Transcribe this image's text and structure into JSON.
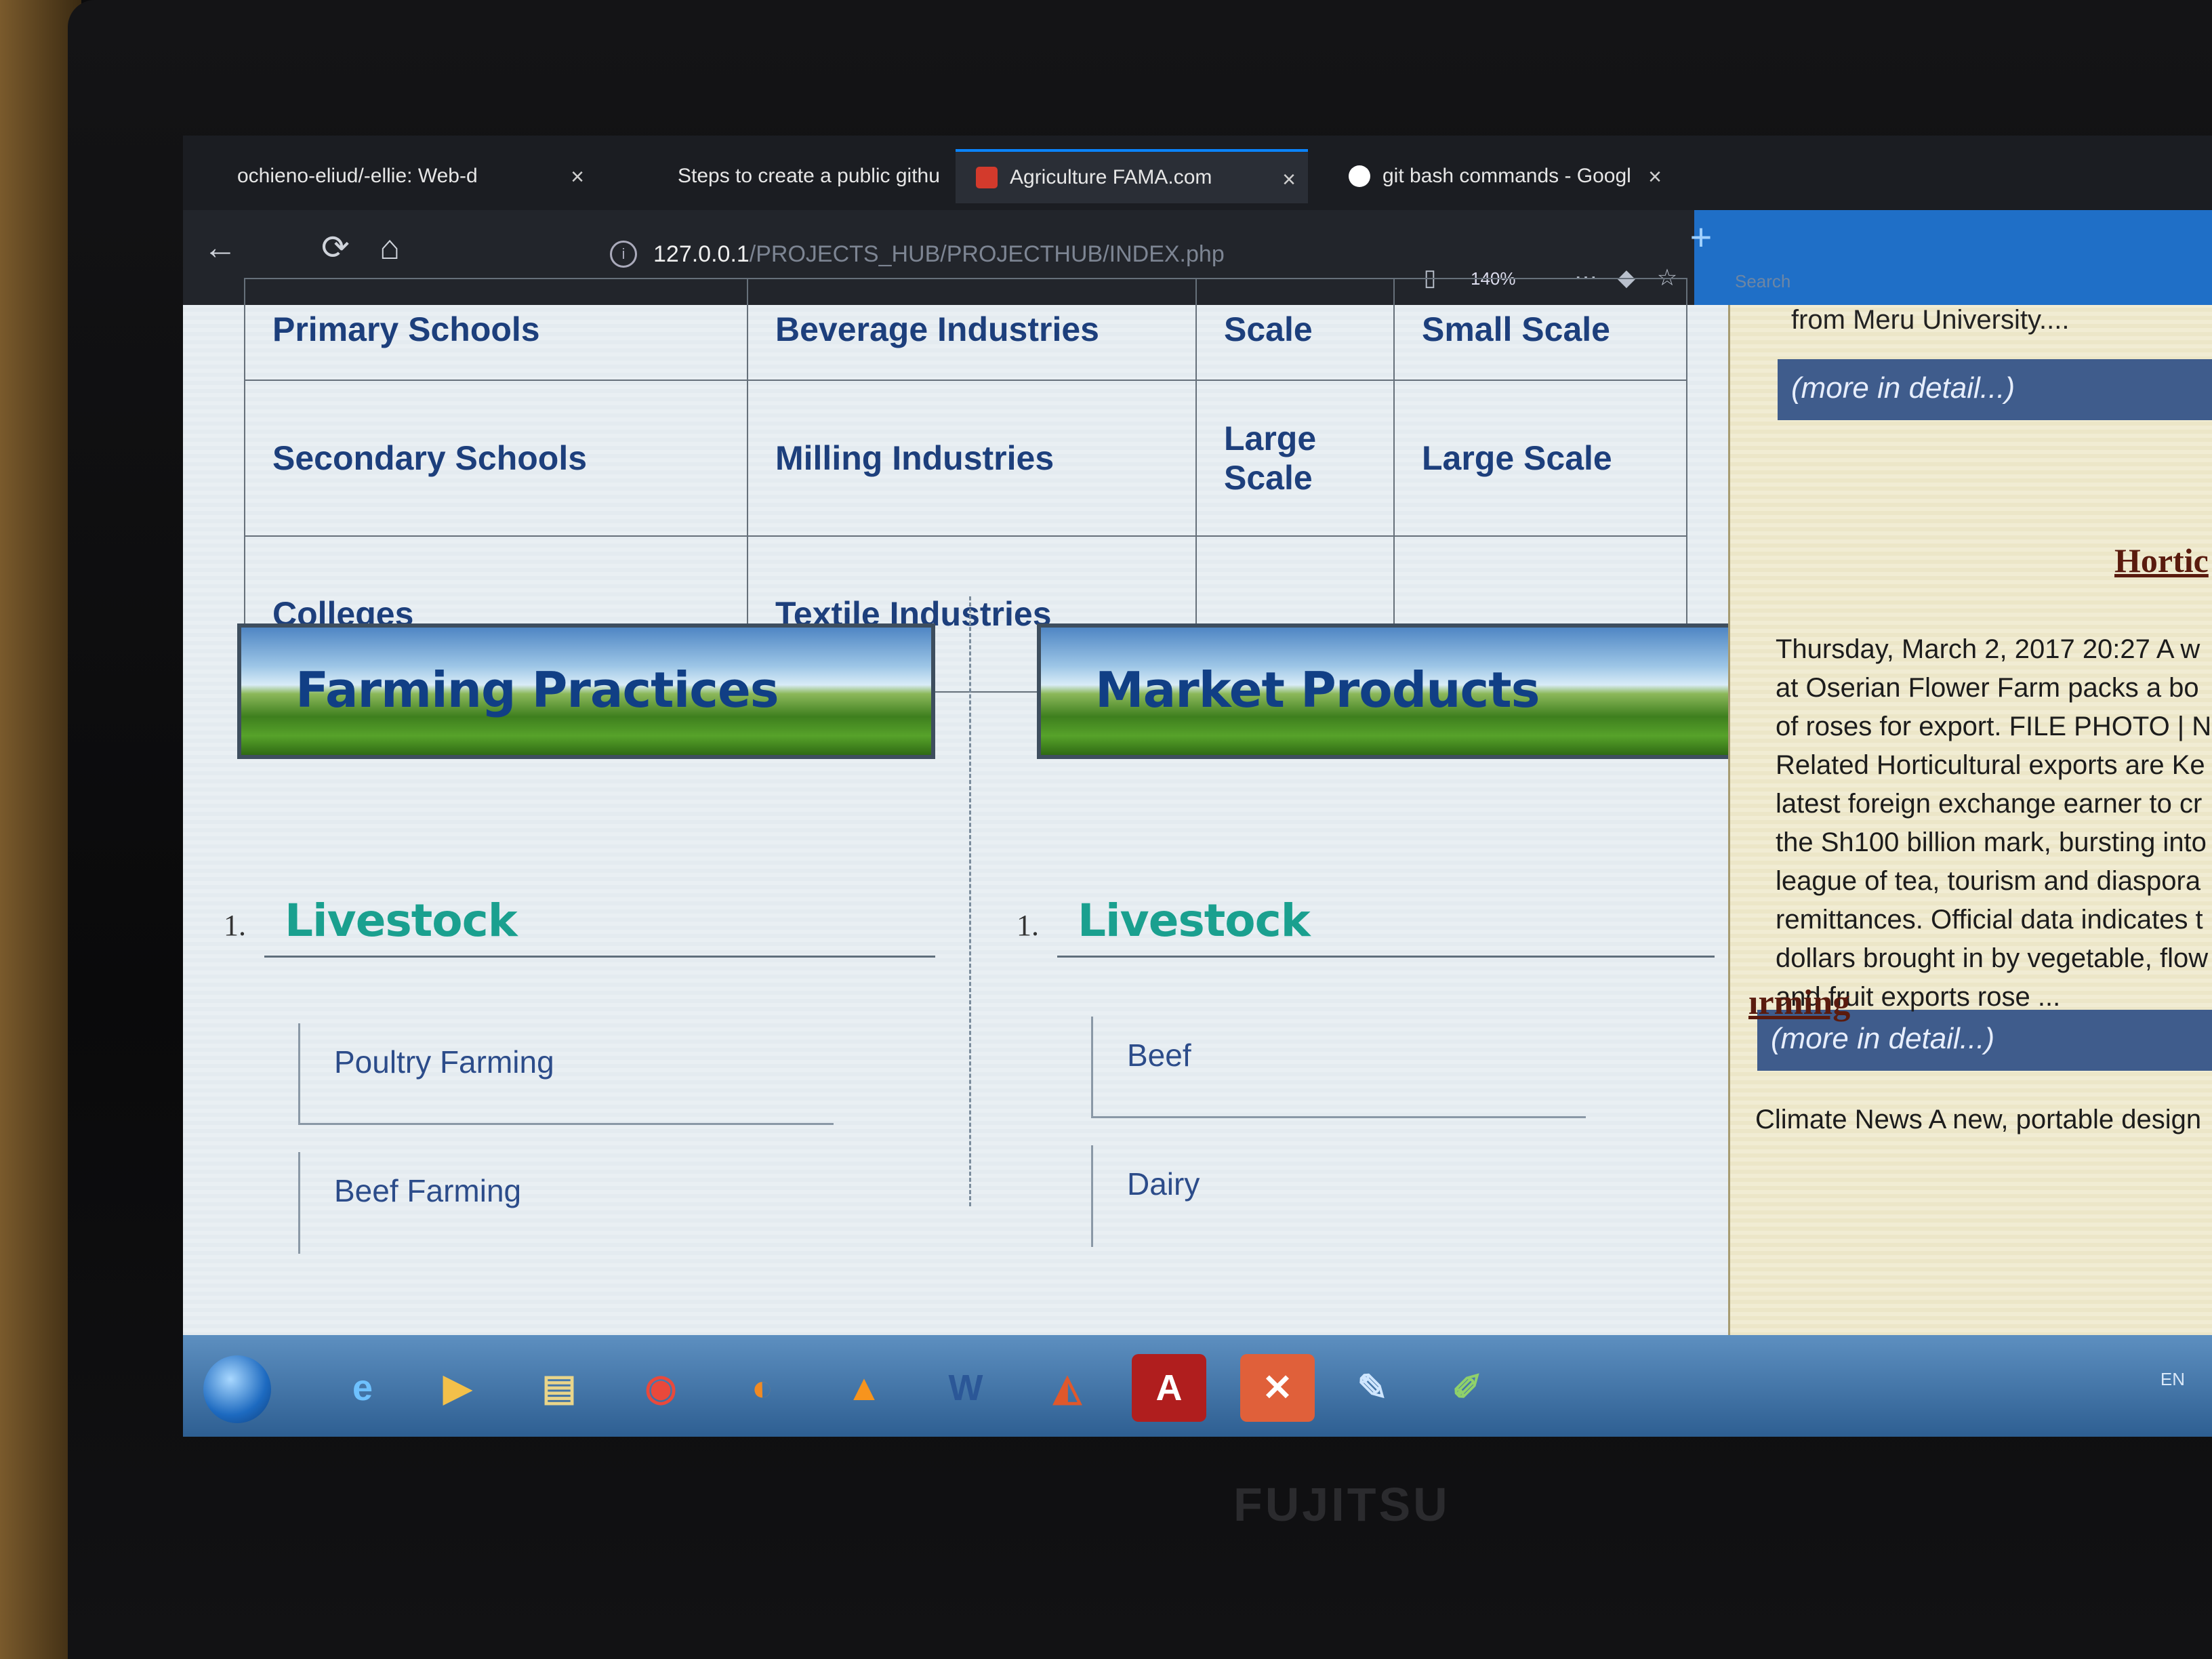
{
  "browser": {
    "tabs": [
      {
        "title": "ochieno-eliud/-ellie: Web-d",
        "close": "×"
      },
      {
        "title": "Steps to create a public githu",
        "close": "×"
      },
      {
        "title": "Agriculture FAMA.com",
        "close": "×",
        "active": true
      },
      {
        "title": "git bash commands - Googl",
        "close": "×"
      }
    ],
    "new_tab": "+",
    "url_host": "127.0.0.1",
    "url_path": "/PROJECTS_HUB/PROJECTHUB/INDEX.php",
    "zoom": "140%",
    "search_placeholder": "Search"
  },
  "table": {
    "rows": [
      [
        "Primary Schools",
        "Beverage Industries",
        "Scale",
        "Small Scale"
      ],
      [
        "Secondary Schools",
        "Milling Industries",
        "Large Scale",
        "Large Scale"
      ],
      [
        "Colleges",
        "Textile Industries",
        "",
        ""
      ]
    ]
  },
  "left_column": {
    "banner": "Farming Practices",
    "list_number": "1.",
    "heading": "Livestock",
    "items": [
      "Poultry Farming",
      "Beef Farming"
    ]
  },
  "middle_column": {
    "banner": "Market Products",
    "list_number": "1.",
    "heading": "Livestock",
    "items": [
      "Beef",
      "Dairy"
    ]
  },
  "sidebar": {
    "top_text": "from Meru University....",
    "more_label": "(more in detail...)",
    "section_title": "Hortic",
    "news_lines": [
      "Thursday, March 2, 2017 20:27 A w",
      "at Oserian Flower Farm packs a bo",
      "of roses for export. FILE PHOTO | N",
      "Related Horticultural exports are Ke",
      "latest foreign exchange earner to cr",
      "the Sh100 billion mark, bursting into",
      "league of tea, tourism and diaspora",
      "remittances. Official data indicates t",
      "dollars brought in by vegetable, flow",
      "and fruit exports rose ..."
    ],
    "second_title": "ırming",
    "climate_text": "Climate News A new, portable design"
  },
  "taskbar": {
    "apps": [
      "start-icon",
      "ie-icon",
      "media-player-icon",
      "file-explorer-icon",
      "chrome-icon",
      "firefox-icon",
      "vlc-icon",
      "word-icon",
      "matlab-icon",
      "acrobat-icon",
      "xampp-icon",
      "paint-icon",
      "notepad-icon"
    ],
    "word_label": "W",
    "tray_text": "EN"
  },
  "device": {
    "brand": "FUJITSU"
  }
}
